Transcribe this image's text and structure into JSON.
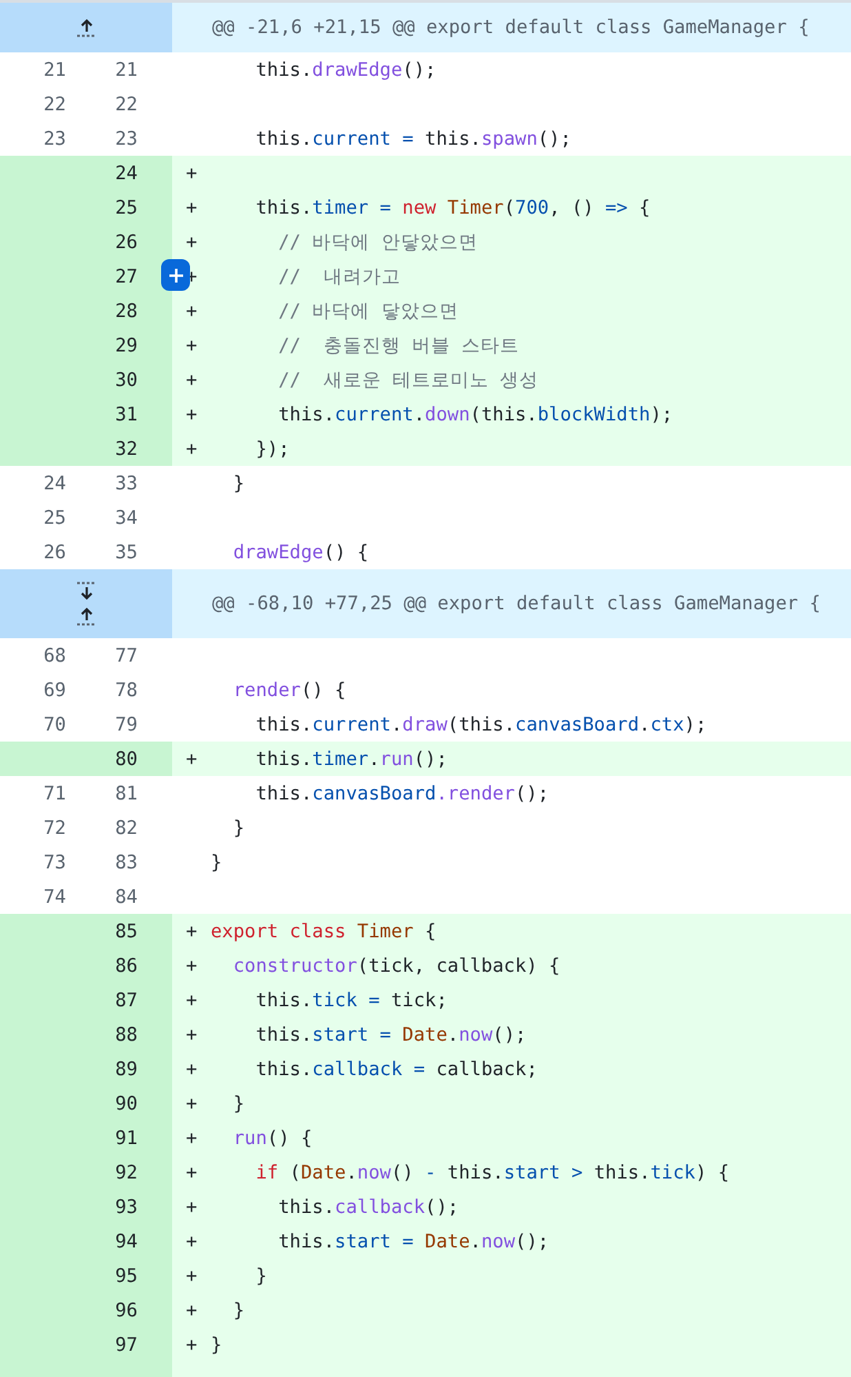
{
  "diff": [
    {
      "kind": "hunk",
      "expand_buttons": [
        {
          "kind": "up"
        }
      ],
      "text": "@@ -21,6 +21,15 @@ export default class GameManager {"
    },
    {
      "kind": "context",
      "old": "21",
      "new": "21",
      "hover": false,
      "tokens": [
        {
          "kind": "plain",
          "text": "    this."
        },
        {
          "kind": "function",
          "text": "drawEdge"
        },
        {
          "kind": "plain",
          "text": "();"
        }
      ]
    },
    {
      "kind": "context",
      "old": "22",
      "new": "22",
      "hover": false
    },
    {
      "kind": "context",
      "old": "23",
      "new": "23",
      "hover": false,
      "tokens": [
        {
          "kind": "plain",
          "text": "    this."
        },
        {
          "kind": "property",
          "text": "current"
        },
        {
          "kind": "operator",
          "text": " = "
        },
        {
          "kind": "plain",
          "text": "this."
        },
        {
          "kind": "function",
          "text": "spawn"
        },
        {
          "kind": "plain",
          "text": "();"
        }
      ]
    },
    {
      "kind": "addition",
      "new": "24",
      "marker": "+",
      "hover": false
    },
    {
      "kind": "addition",
      "new": "25",
      "marker": "+",
      "hover": false,
      "tokens": [
        {
          "kind": "plain",
          "text": "    this."
        },
        {
          "kind": "property",
          "text": "timer"
        },
        {
          "kind": "operator",
          "text": " = "
        },
        {
          "kind": "keyword",
          "text": "new "
        },
        {
          "kind": "class",
          "text": "Timer"
        },
        {
          "kind": "plain",
          "text": "("
        },
        {
          "kind": "number",
          "text": "700"
        },
        {
          "kind": "plain",
          "text": ", () "
        },
        {
          "kind": "operator",
          "text": "=>"
        },
        {
          "kind": "plain",
          "text": " {"
        }
      ]
    },
    {
      "kind": "addition",
      "new": "26",
      "marker": "+",
      "hover": false,
      "tokens": [
        {
          "kind": "comment",
          "text": "      // 바닥에 안닿았으면"
        }
      ]
    },
    {
      "kind": "addition",
      "new": "27",
      "marker": "+",
      "hover": true,
      "tokens": [
        {
          "kind": "comment",
          "text": "      //  내려가고"
        }
      ]
    },
    {
      "kind": "addition",
      "new": "28",
      "marker": "+",
      "hover": false,
      "tokens": [
        {
          "kind": "comment",
          "text": "      // 바닥에 닿았으면"
        }
      ]
    },
    {
      "kind": "addition",
      "new": "29",
      "marker": "+",
      "hover": false,
      "tokens": [
        {
          "kind": "comment",
          "text": "      //  충돌진행 버블 스타트"
        }
      ]
    },
    {
      "kind": "addition",
      "new": "30",
      "marker": "+",
      "hover": false,
      "tokens": [
        {
          "kind": "comment",
          "text": "      //  새로운 테트로미노 생성"
        }
      ]
    },
    {
      "kind": "addition",
      "new": "31",
      "marker": "+",
      "hover": false,
      "tokens": [
        {
          "kind": "plain",
          "text": "      this."
        },
        {
          "kind": "property",
          "text": "current"
        },
        {
          "kind": "plain",
          "text": "."
        },
        {
          "kind": "function",
          "text": "down"
        },
        {
          "kind": "plain",
          "text": "(this."
        },
        {
          "kind": "property",
          "text": "blockWidth"
        },
        {
          "kind": "plain",
          "text": ");"
        }
      ]
    },
    {
      "kind": "addition",
      "new": "32",
      "marker": "+",
      "hover": false,
      "tokens": [
        {
          "kind": "plain",
          "text": "    });"
        }
      ]
    },
    {
      "kind": "context",
      "old": "24",
      "new": "33",
      "hover": false,
      "tokens": [
        {
          "kind": "plain",
          "text": "  }"
        }
      ]
    },
    {
      "kind": "context",
      "old": "25",
      "new": "34",
      "hover": false
    },
    {
      "kind": "context",
      "old": "26",
      "new": "35",
      "hover": false,
      "tokens": [
        {
          "kind": "function",
          "text": "  drawEdge"
        },
        {
          "kind": "plain",
          "text": "() {"
        }
      ]
    },
    {
      "kind": "hunk",
      "expand_buttons": [
        {
          "kind": "down"
        },
        {
          "kind": "up"
        }
      ],
      "text": "@@ -68,10 +77,25 @@ export default class GameManager {"
    },
    {
      "kind": "context",
      "old": "68",
      "new": "77",
      "hover": false
    },
    {
      "kind": "context",
      "old": "69",
      "new": "78",
      "hover": false,
      "tokens": [
        {
          "kind": "function",
          "text": "  render"
        },
        {
          "kind": "plain",
          "text": "() {"
        }
      ]
    },
    {
      "kind": "context",
      "old": "70",
      "new": "79",
      "hover": false,
      "tokens": [
        {
          "kind": "plain",
          "text": "    this."
        },
        {
          "kind": "property",
          "text": "current"
        },
        {
          "kind": "plain",
          "text": "."
        },
        {
          "kind": "function",
          "text": "draw"
        },
        {
          "kind": "plain",
          "text": "(this."
        },
        {
          "kind": "property",
          "text": "canvasBoard"
        },
        {
          "kind": "plain",
          "text": "."
        },
        {
          "kind": "property",
          "text": "ctx"
        },
        {
          "kind": "plain",
          "text": ");"
        }
      ]
    },
    {
      "kind": "addition",
      "new": "80",
      "marker": "+",
      "hover": false,
      "tokens": [
        {
          "kind": "plain",
          "text": "    this."
        },
        {
          "kind": "property",
          "text": "timer"
        },
        {
          "kind": "plain",
          "text": "."
        },
        {
          "kind": "function",
          "text": "run"
        },
        {
          "kind": "plain",
          "text": "();"
        }
      ]
    },
    {
      "kind": "context",
      "old": "71",
      "new": "81",
      "hover": false,
      "tokens": [
        {
          "kind": "plain",
          "text": "    this."
        },
        {
          "kind": "property",
          "text": "canvasBoard"
        },
        {
          "kind": "function",
          "text": ".render"
        },
        {
          "kind": "plain",
          "text": "();"
        }
      ]
    },
    {
      "kind": "context",
      "old": "72",
      "new": "82",
      "hover": false,
      "tokens": [
        {
          "kind": "plain",
          "text": "  }"
        }
      ]
    },
    {
      "kind": "context",
      "old": "73",
      "new": "83",
      "hover": false,
      "tokens": [
        {
          "kind": "plain",
          "text": "}"
        }
      ]
    },
    {
      "kind": "context",
      "old": "74",
      "new": "84",
      "hover": false
    },
    {
      "kind": "addition",
      "new": "85",
      "marker": "+",
      "hover": false,
      "tokens": [
        {
          "kind": "keyword",
          "text": "export class "
        },
        {
          "kind": "class",
          "text": "Timer"
        },
        {
          "kind": "plain",
          "text": " {"
        }
      ]
    },
    {
      "kind": "addition",
      "new": "86",
      "marker": "+",
      "hover": false,
      "tokens": [
        {
          "kind": "function",
          "text": "  constructor"
        },
        {
          "kind": "plain",
          "text": "(tick, callback) {"
        }
      ]
    },
    {
      "kind": "addition",
      "new": "87",
      "marker": "+",
      "hover": false,
      "tokens": [
        {
          "kind": "plain",
          "text": "    this."
        },
        {
          "kind": "property",
          "text": "tick"
        },
        {
          "kind": "operator",
          "text": " = "
        },
        {
          "kind": "plain",
          "text": "tick;"
        }
      ]
    },
    {
      "kind": "addition",
      "new": "88",
      "marker": "+",
      "hover": false,
      "tokens": [
        {
          "kind": "plain",
          "text": "    this."
        },
        {
          "kind": "property",
          "text": "start"
        },
        {
          "kind": "operator",
          "text": " = "
        },
        {
          "kind": "class",
          "text": "Date"
        },
        {
          "kind": "plain",
          "text": "."
        },
        {
          "kind": "function",
          "text": "now"
        },
        {
          "kind": "plain",
          "text": "();"
        }
      ]
    },
    {
      "kind": "addition",
      "new": "89",
      "marker": "+",
      "hover": false,
      "tokens": [
        {
          "kind": "plain",
          "text": "    this."
        },
        {
          "kind": "property",
          "text": "callback"
        },
        {
          "kind": "operator",
          "text": " = "
        },
        {
          "kind": "plain",
          "text": "callback;"
        }
      ]
    },
    {
      "kind": "addition",
      "new": "90",
      "marker": "+",
      "hover": false,
      "tokens": [
        {
          "kind": "plain",
          "text": "  }"
        }
      ]
    },
    {
      "kind": "addition",
      "new": "91",
      "marker": "+",
      "hover": false,
      "tokens": [
        {
          "kind": "function",
          "text": "  run"
        },
        {
          "kind": "plain",
          "text": "() {"
        }
      ]
    },
    {
      "kind": "addition",
      "new": "92",
      "marker": "+",
      "hover": false,
      "tokens": [
        {
          "kind": "keyword",
          "text": "    if"
        },
        {
          "kind": "plain",
          "text": " ("
        },
        {
          "kind": "class",
          "text": "Date"
        },
        {
          "kind": "plain",
          "text": "."
        },
        {
          "kind": "function",
          "text": "now"
        },
        {
          "kind": "plain",
          "text": "()"
        },
        {
          "kind": "operator",
          "text": " - "
        },
        {
          "kind": "plain",
          "text": "this."
        },
        {
          "kind": "property",
          "text": "start"
        },
        {
          "kind": "operator",
          "text": " > "
        },
        {
          "kind": "plain",
          "text": "this."
        },
        {
          "kind": "property",
          "text": "tick"
        },
        {
          "kind": "plain",
          "text": ") {"
        }
      ]
    },
    {
      "kind": "addition",
      "new": "93",
      "marker": "+",
      "hover": false,
      "tokens": [
        {
          "kind": "plain",
          "text": "      this."
        },
        {
          "kind": "function",
          "text": "callback"
        },
        {
          "kind": "plain",
          "text": "();"
        }
      ]
    },
    {
      "kind": "addition",
      "new": "94",
      "marker": "+",
      "hover": false,
      "tokens": [
        {
          "kind": "plain",
          "text": "      this."
        },
        {
          "kind": "property",
          "text": "start"
        },
        {
          "kind": "operator",
          "text": " = "
        },
        {
          "kind": "class",
          "text": "Date"
        },
        {
          "kind": "plain",
          "text": "."
        },
        {
          "kind": "function",
          "text": "now"
        },
        {
          "kind": "plain",
          "text": "();"
        }
      ]
    },
    {
      "kind": "addition",
      "new": "95",
      "marker": "+",
      "hover": false,
      "tokens": [
        {
          "kind": "plain",
          "text": "    }"
        }
      ]
    },
    {
      "kind": "addition",
      "new": "96",
      "marker": "+",
      "hover": false,
      "tokens": [
        {
          "kind": "plain",
          "text": "  }"
        }
      ]
    },
    {
      "kind": "addition",
      "new": "97",
      "marker": "+",
      "hover": false,
      "tokens": [
        {
          "kind": "plain",
          "text": "}"
        }
      ]
    },
    {
      "kind": "addition"
    }
  ]
}
